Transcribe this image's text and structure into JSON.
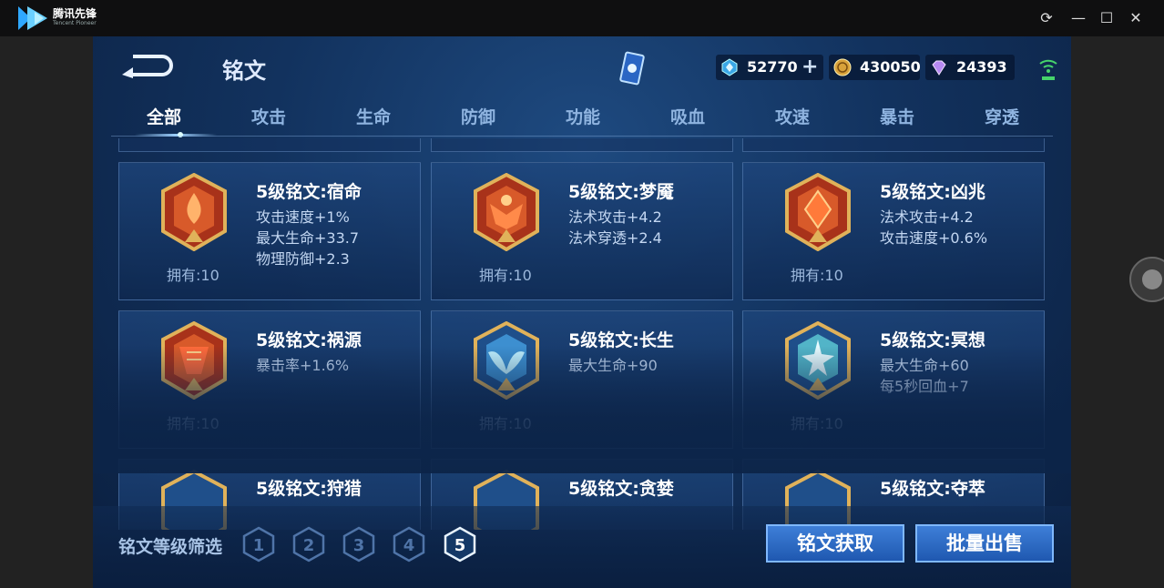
{
  "window": {
    "app_name": "腾讯先锋",
    "app_subname": "Tencent Pioneer"
  },
  "header": {
    "title": "铭文",
    "currencies": [
      {
        "icon": "crystal-coupon-icon",
        "value": "52770"
      },
      {
        "icon": "gold-coin-icon",
        "value": "430050"
      },
      {
        "icon": "purple-gem-icon",
        "value": "24393"
      }
    ]
  },
  "tabs": [
    "全部",
    "攻击",
    "生命",
    "防御",
    "功能",
    "吸血",
    "攻速",
    "暴击",
    "穿透"
  ],
  "active_tab": 0,
  "runes": [
    {
      "name": "5级铭文:宿命",
      "stats": [
        "攻击速度+1%",
        "最大生命+33.7",
        "物理防御+2.3"
      ],
      "owned": "拥有:10",
      "color": "red"
    },
    {
      "name": "5级铭文:梦魇",
      "stats": [
        "法术攻击+4.2",
        "法术穿透+2.4"
      ],
      "owned": "拥有:10",
      "color": "red"
    },
    {
      "name": "5级铭文:凶兆",
      "stats": [
        "法术攻击+4.2",
        "攻击速度+0.6%"
      ],
      "owned": "拥有:10",
      "color": "red"
    },
    {
      "name": "5级铭文:祸源",
      "stats": [
        "暴击率+1.6%"
      ],
      "owned": "拥有:10",
      "color": "red"
    },
    {
      "name": "5级铭文:长生",
      "stats": [
        "最大生命+90"
      ],
      "owned": "拥有:10",
      "color": "blue"
    },
    {
      "name": "5级铭文:冥想",
      "stats": [
        "最大生命+60",
        "每5秒回血+7"
      ],
      "owned": "拥有:10",
      "color": "blue"
    },
    {
      "name": "5级铭文:狩猎",
      "stats": [],
      "owned": "",
      "color": "blue"
    },
    {
      "name": "5级铭文:贪婪",
      "stats": [],
      "owned": "",
      "color": "blue"
    },
    {
      "name": "5级铭文:夺萃",
      "stats": [],
      "owned": "",
      "color": "blue"
    }
  ],
  "filter": {
    "label": "铭文等级筛选",
    "levels": [
      "1",
      "2",
      "3",
      "4",
      "5"
    ],
    "selected": "5"
  },
  "actions": {
    "obtain": "铭文获取",
    "bulk_sell": "批量出售"
  },
  "colors": {
    "red_rune": "#c8431f",
    "blue_rune": "#3d8fd0",
    "gold_frame": "#e0b25a",
    "button_blue": "#2f6fcb"
  }
}
